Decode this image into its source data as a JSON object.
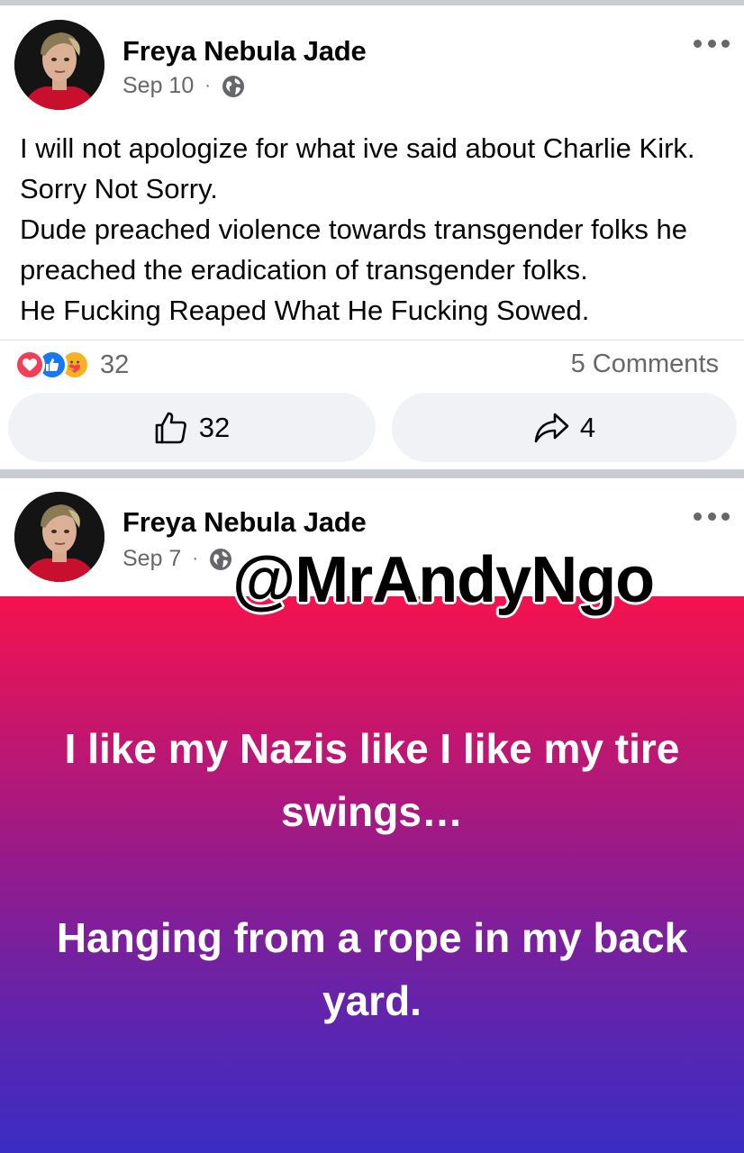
{
  "posts": [
    {
      "author": "Freya Nebula Jade",
      "date": "Sep 10",
      "separator": "·",
      "privacy_icon": "globe-icon",
      "text": "I will not apologize for what ive said about Charlie Kirk. Sorry Not Sorry.\nDude preached violence towards transgender folks he preached the eradication of transgender folks.\nHe Fucking Reaped What He Fucking Sowed.",
      "reactions": [
        "love-reaction-icon",
        "like-reaction-icon",
        "care-reaction-icon"
      ],
      "reaction_count": "32",
      "comments": "5 Comments",
      "like_count": "32",
      "share_count": "4"
    },
    {
      "author": "Freya Nebula Jade",
      "date": "Sep 7",
      "separator": "·",
      "privacy_icon": "globe-icon",
      "background_text": "I like my Nazis like I like my tire swings…\n\nHanging from a rope in my back yard.",
      "gradient_colors": [
        "#f5124e",
        "#9b1a88",
        "#5b25b0",
        "#3a2dc2"
      ]
    }
  ],
  "watermark": "@MrAndyNgo",
  "colors": {
    "secondary_text": "#65676b",
    "button_bg": "#f0f2f5",
    "separator": "#c9ccd1"
  }
}
